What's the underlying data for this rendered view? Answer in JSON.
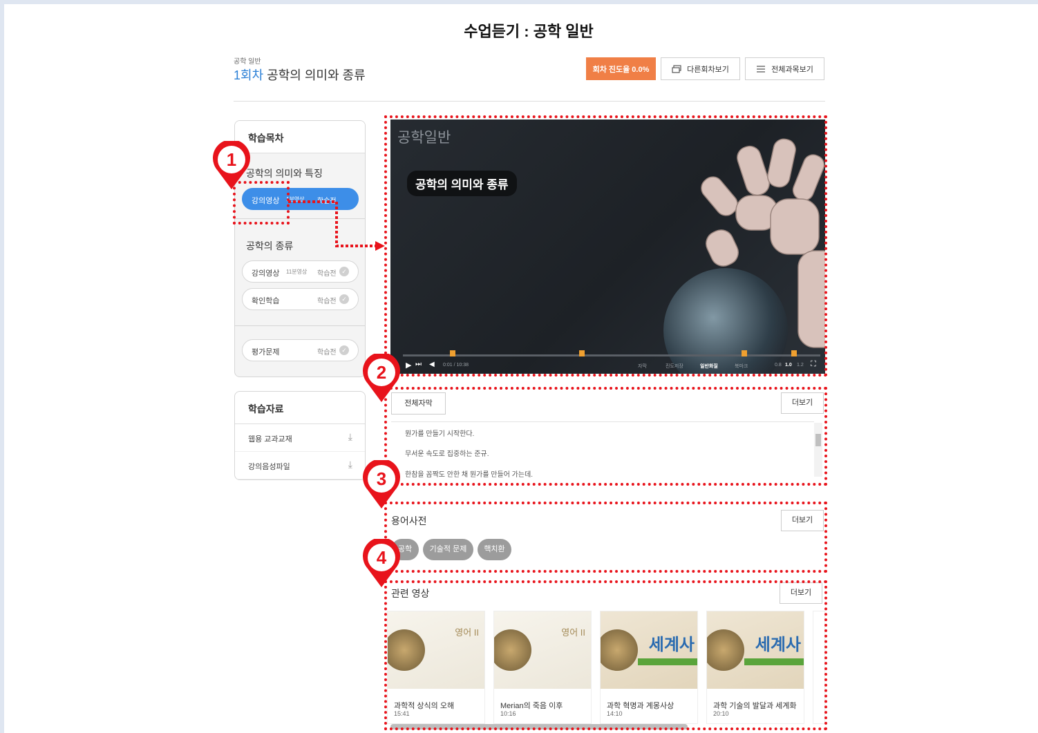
{
  "page_title": "수업듣기 : 공학 일반",
  "course": {
    "subject": "공학 일반",
    "session_num": "1회차",
    "session_title": "공학의 의미와 종류"
  },
  "header_buttons": {
    "progress": "회차 진도율 0.0%",
    "other_sessions": "다른회차보기",
    "all_subjects": "전체과목보기"
  },
  "toc": {
    "title": "학습목차",
    "sections": [
      {
        "title": "공학의 의미와 특징",
        "items": [
          {
            "label": "강의영상",
            "duration": "1분영상",
            "status": "학습전",
            "active": true
          }
        ]
      },
      {
        "title": "공학의 종류",
        "items": [
          {
            "label": "강의영상",
            "duration": "11분영상",
            "status": "학습전"
          },
          {
            "label": "확인학습",
            "duration": "",
            "status": "학습전"
          }
        ]
      },
      {
        "title": "",
        "items": [
          {
            "label": "평가문제",
            "duration": "",
            "status": "학습전"
          }
        ]
      }
    ]
  },
  "resources": {
    "title": "학습자료",
    "items": [
      "웹용 교과교재",
      "강의음성파일"
    ]
  },
  "video": {
    "brand": "공학일반",
    "title": "공학의 의미와 종류",
    "time": "0:01 / 10:38",
    "controls": {
      "subtitle": "자막",
      "progress_save": "진도저장",
      "quality": "일반화질",
      "bookmark": "북마크",
      "speeds": [
        "0.8",
        "1.0",
        "1.2"
      ]
    }
  },
  "subtitles": {
    "button": "전체자막",
    "more": "더보기",
    "lines": [
      "뭔가를 만들기 시작한다.",
      "무서운 속도로 집중하는 준규.",
      "한참을 꼼짝도 안한 채 뭔가를 만들어 가는데."
    ]
  },
  "glossary": {
    "title": "용어사전",
    "more": "더보기",
    "terms": [
      "공학",
      "기술적 문제",
      "핵치환"
    ]
  },
  "related": {
    "title": "관련 영상",
    "more": "더보기",
    "videos": [
      {
        "title": "과학적 상식의 오해",
        "time": "15:41",
        "thumb": "영어 II"
      },
      {
        "title": "Merian의 죽음 이후",
        "time": "10:16",
        "thumb": "영어 II"
      },
      {
        "title": "과학 혁명과 계몽사상",
        "time": "14:10",
        "thumb": "세계사"
      },
      {
        "title": "과학 기술의 발달과 세계화",
        "time": "20:10",
        "thumb": "세계사"
      }
    ]
  },
  "annotations": [
    "1",
    "2",
    "3",
    "4"
  ],
  "colors": {
    "accent_blue": "#3d8ee8",
    "progress_orange": "#f07f46",
    "annotation_red": "#e8131b"
  }
}
